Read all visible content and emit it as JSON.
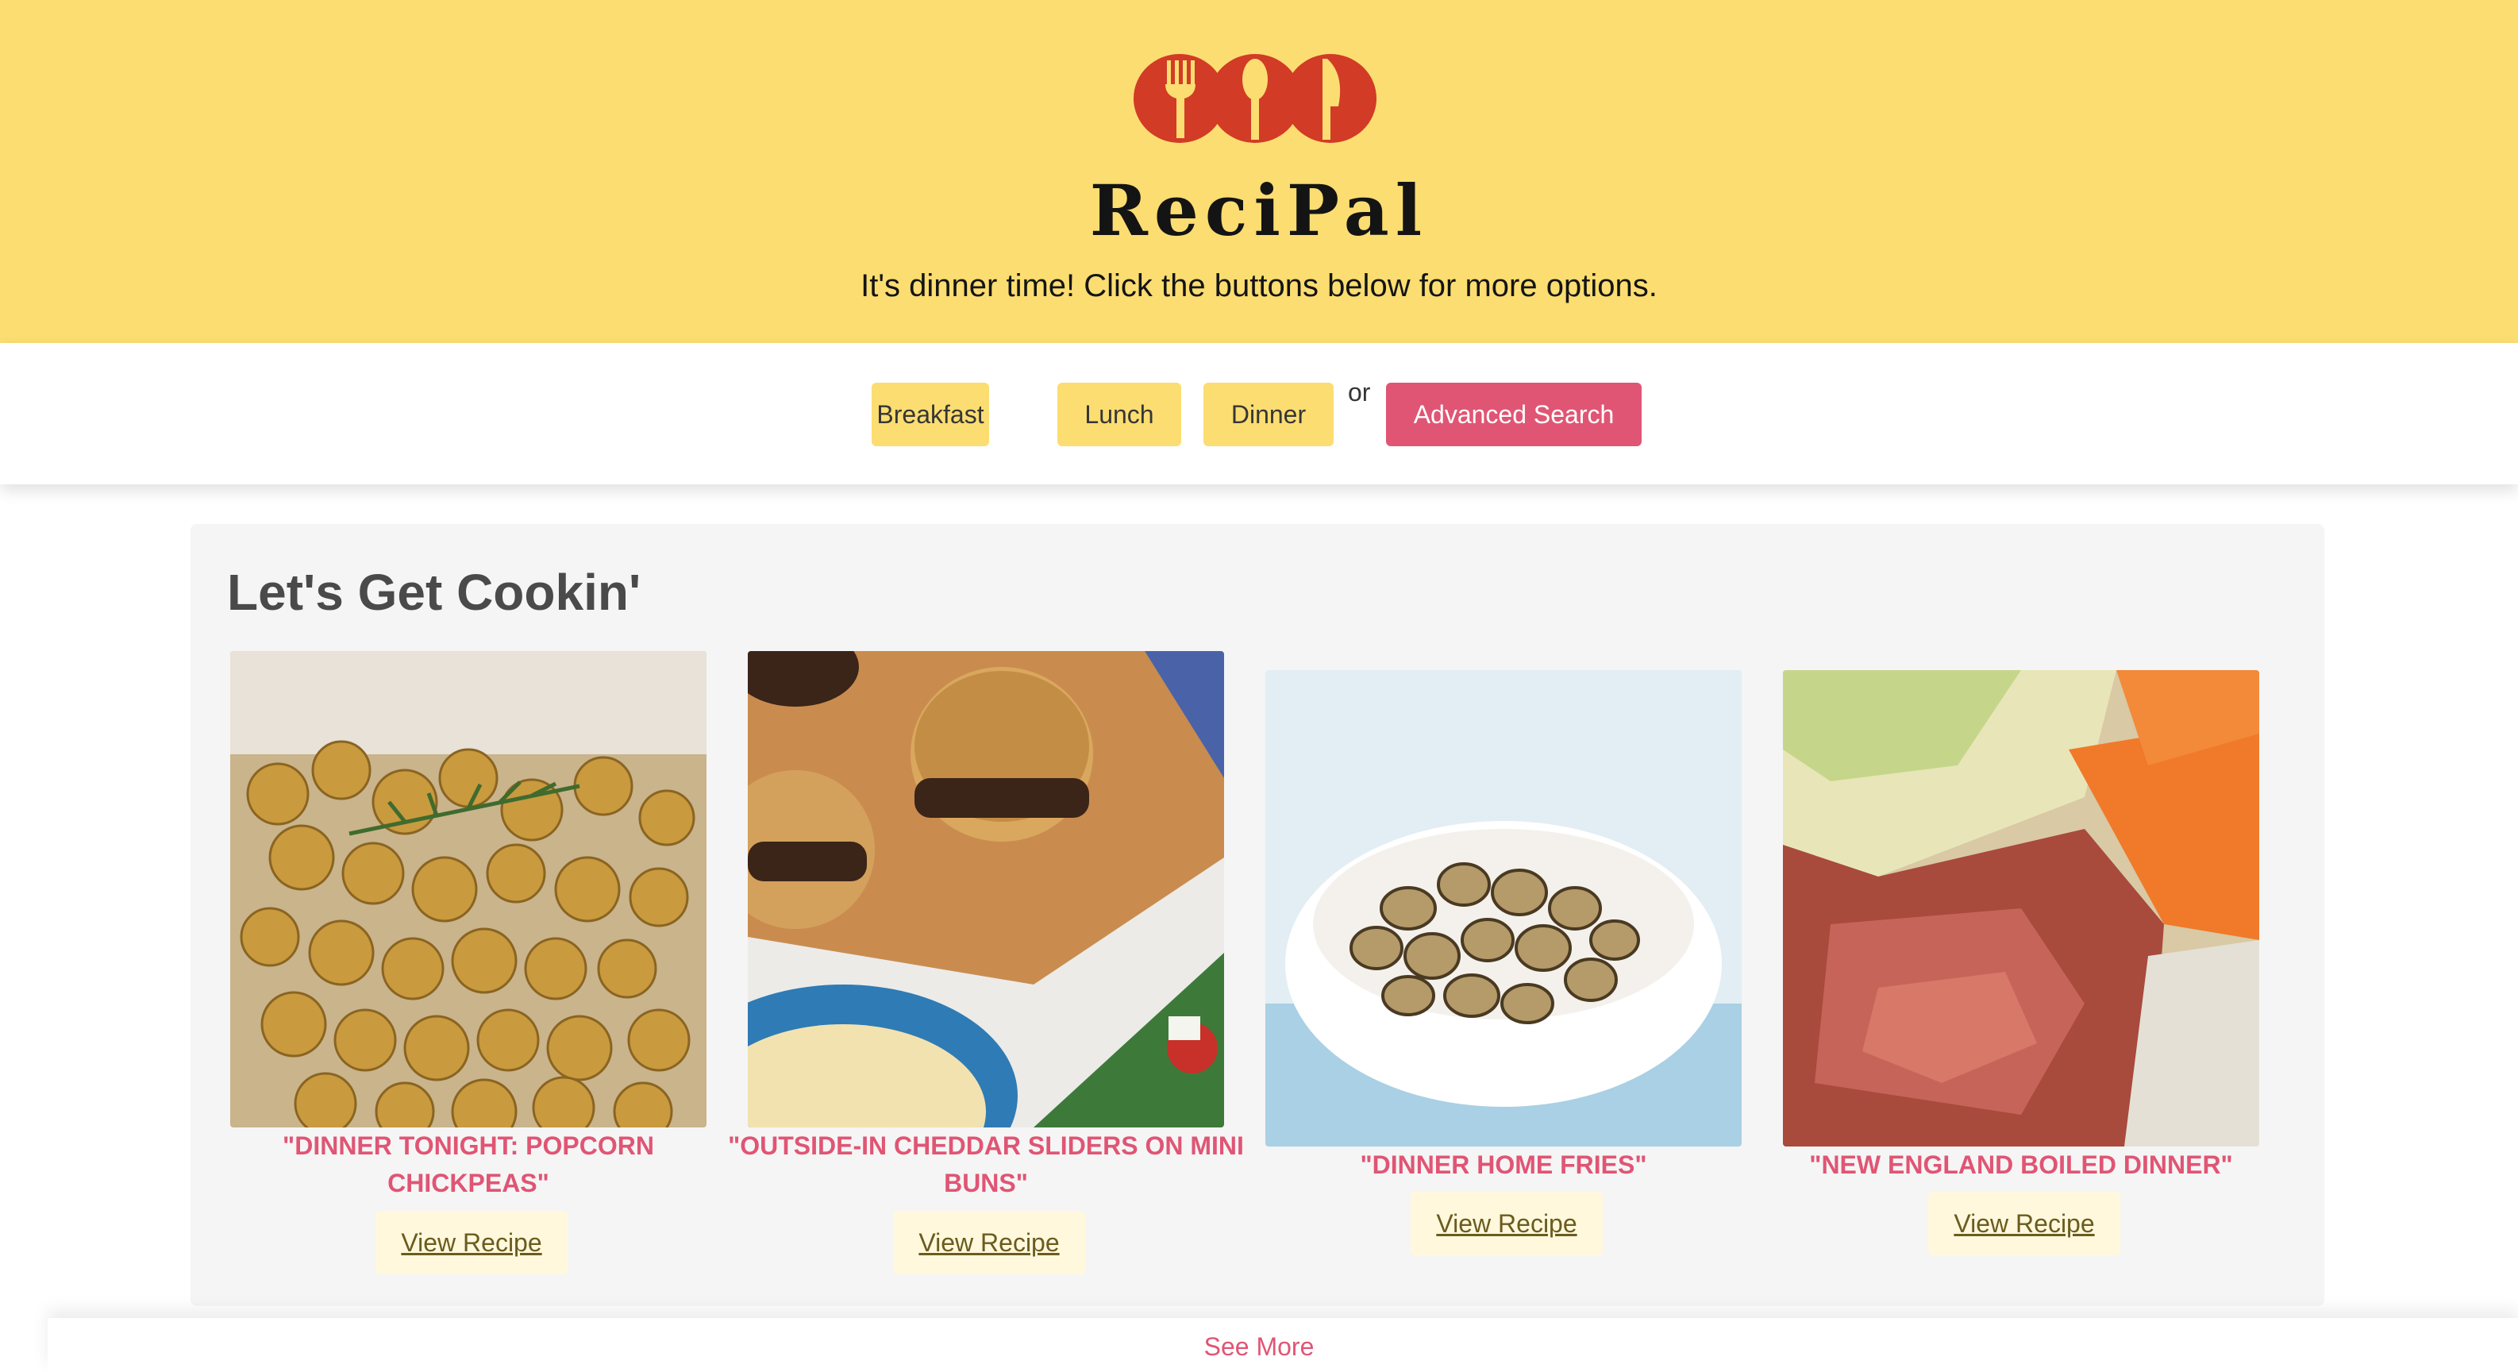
{
  "header": {
    "brand": "ReciPal",
    "tagline": "It's dinner time! Click the buttons below for more options.",
    "logo_icon": "cutlery-logo-icon",
    "bg_color": "#fbdd71"
  },
  "nav": {
    "breakfast": "Breakfast",
    "lunch": "Lunch",
    "dinner": "Dinner",
    "or": "or",
    "advanced": "Advanced Search"
  },
  "main": {
    "title": "Let's Get Cookin'",
    "cards": [
      {
        "title": "\"DINNER TONIGHT: POPCORN CHICKPEAS\"",
        "button": "View Recipe",
        "image": "chickpeas-photo"
      },
      {
        "title": "\"OUTSIDE-IN CHEDDAR SLIDERS ON MINI BUNS\"",
        "button": "View Recipe",
        "image": "sliders-photo"
      },
      {
        "title": "\"DINNER HOME FRIES\"",
        "button": "View Recipe",
        "image": "home-fries-photo"
      },
      {
        "title": "\"NEW ENGLAND BOILED DINNER\"",
        "button": "View Recipe",
        "image": "boiled-dinner-photo"
      }
    ]
  },
  "footer": {
    "see_more": "See More"
  },
  "colors": {
    "accent_pink": "#e05574",
    "yellow": "#fbdd71"
  }
}
